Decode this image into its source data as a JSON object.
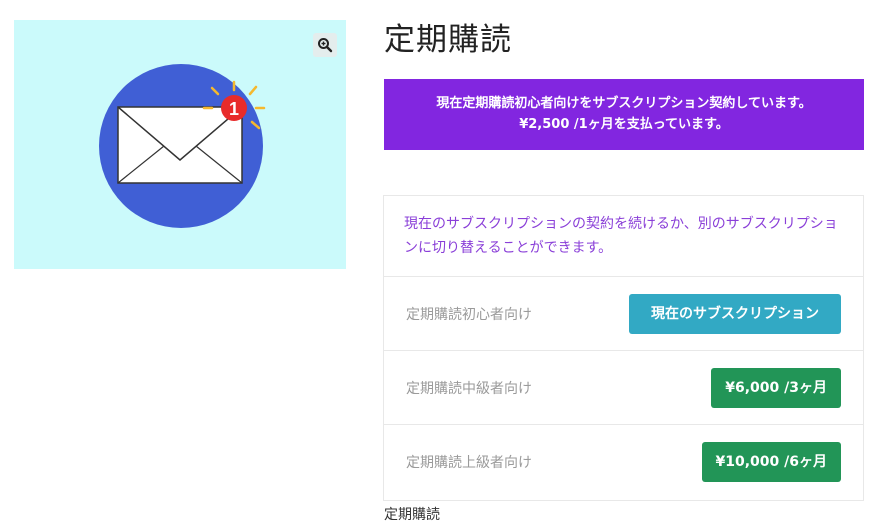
{
  "product": {
    "image_alt": "envelope notification illustration",
    "badge_count": "1",
    "zoom_icon": "zoom-in-icon",
    "colors": {
      "panel_bg": "#cbfafb",
      "circle": "#405fd5",
      "badge": "#e82b2b",
      "rays": "#f5b82e"
    }
  },
  "title": "定期購読",
  "notice": {
    "line1": "現在定期購読初心者向けをサブスクリプション契約しています。",
    "line2": "¥2,500 /1ヶ月を支払っています。",
    "color": "#8226e0"
  },
  "switch": {
    "intro": "現在のサブスクリプションの契約を続けるか、別のサブスクリプションに切り替えることができます。",
    "plans": [
      {
        "name": "定期購読初心者向け",
        "action": "現在のサブスクリプション"
      },
      {
        "name": "定期購読中級者向け",
        "action": "¥6,000 /3ヶ月"
      },
      {
        "name": "定期購読上級者向け",
        "action": "¥10,000 /6ヶ月"
      }
    ],
    "colors": {
      "current": "#32a9c4",
      "switch": "#229557"
    }
  },
  "caption": "定期購読"
}
